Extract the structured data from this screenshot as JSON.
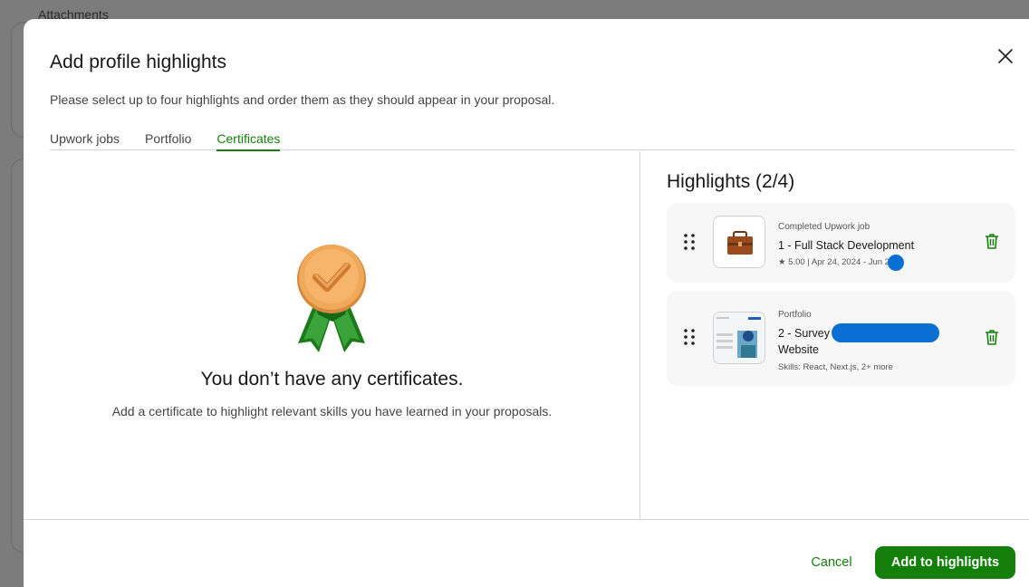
{
  "background": {
    "section_label": "Attachments"
  },
  "modal": {
    "title": "Add profile highlights",
    "subtitle": "Please select up to four highlights and order them as they should appear in your proposal.",
    "close_icon": "close-icon",
    "tabs": [
      {
        "label": "Upwork jobs",
        "active": false
      },
      {
        "label": "Portfolio",
        "active": false
      },
      {
        "label": "Certificates",
        "active": true
      }
    ],
    "empty_state": {
      "icon": "award-ribbon-icon",
      "title": "You don’t have any certificates.",
      "description": "Add a certificate to highlight relevant skills you have learned in your proposals."
    },
    "highlights": {
      "title": "Highlights (2/4)",
      "items": [
        {
          "type": "Completed Upwork job",
          "name": "1 - Full Stack Development",
          "meta": "★ 5.00 | Apr 24, 2024 - Jun 2024",
          "thumb_icon": "briefcase-icon"
        },
        {
          "type": "Portfolio",
          "name_line1": "2 - Survey",
          "name_line2": "Website",
          "meta": "Skills: React, Next.js, 2+ more",
          "thumb_icon": "portfolio-preview-image"
        }
      ]
    },
    "footer": {
      "cancel_label": "Cancel",
      "add_label": "Add to highlights"
    }
  },
  "colors": {
    "accent": "#14800b",
    "overlay": "#7a7a7a",
    "card_bg": "#f7f7f7"
  }
}
